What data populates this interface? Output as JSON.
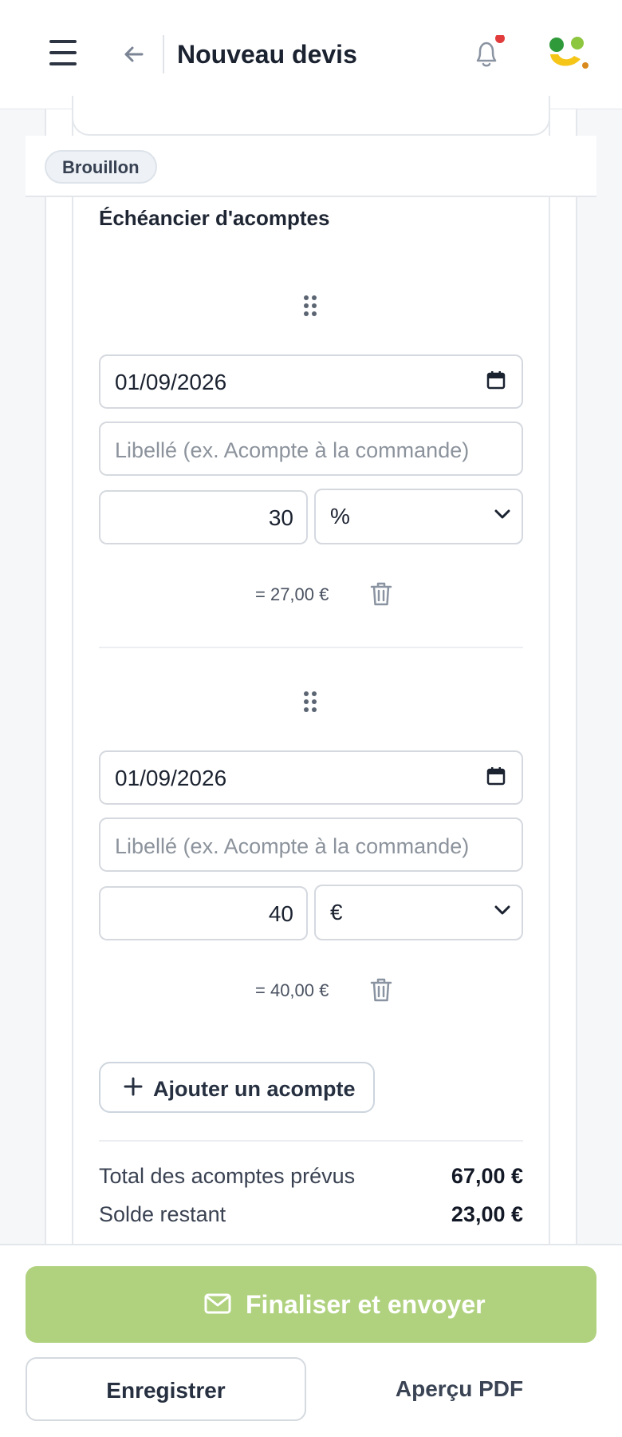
{
  "header": {
    "title": "Nouveau devis",
    "notification_dot_color": "#e23b3b",
    "icons": [
      "menu-icon",
      "arrow-left-icon",
      "bell-icon",
      "app-logo"
    ]
  },
  "status": {
    "badge": "Brouillon"
  },
  "schedule": {
    "title": "Échéancier d'acomptes",
    "installments": [
      {
        "date": "01/09/2026",
        "label_placeholder": "Libellé (ex. Acompte à la commande)",
        "amount": "30",
        "unit": "%",
        "computed": "= 27,00 €"
      },
      {
        "date": "01/09/2026",
        "label_placeholder": "Libellé (ex. Acompte à la commande)",
        "amount": "40",
        "unit": "€",
        "computed": "= 40,00 €"
      }
    ],
    "add_button": "Ajouter un acompte",
    "summary": {
      "total_label": "Total des acomptes prévus",
      "total_value": "67,00 €",
      "balance_label": "Solde restant",
      "balance_value": "23,00 €"
    }
  },
  "footer": {
    "primary": "Finaliser et envoyer",
    "save": "Enregistrer",
    "preview": "Aperçu PDF",
    "primary_color": "#b0d27f"
  }
}
